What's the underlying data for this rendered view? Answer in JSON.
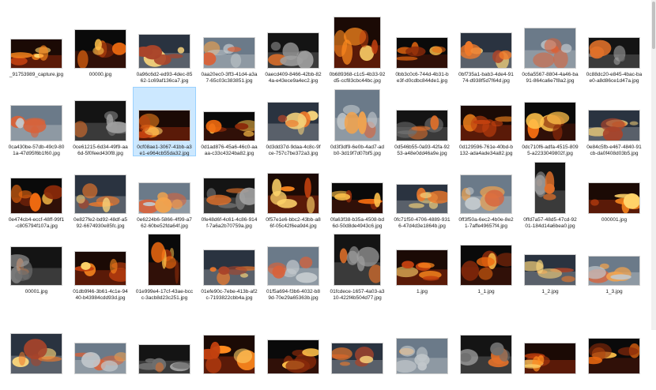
{
  "explorer": {
    "selected_index": 12,
    "rows": [
      [
        {
          "caption": "_91753989_capture.jpg",
          "icon": "image-icon"
        },
        {
          "caption": "00000.jpg",
          "icon": "image-icon"
        },
        {
          "caption": "0a96c6d2-ed93-4dec-85\n62-1c69af136ca7.jpg",
          "icon": "image-icon"
        },
        {
          "caption": "0aa20ec0-3ff3-41d4-a3a\n7-65c03c383851.jpg",
          "icon": "image-icon"
        },
        {
          "caption": "0aecd409-8466-42bb-82\n4a-e43ece9a4ec2.jpg",
          "icon": "image-icon"
        },
        {
          "caption": "0b689368-c1c5-4b33-92\nd5-ccf83cbc44bc.jpg",
          "icon": "image-icon"
        },
        {
          "caption": "0bb3c0c6-744d-4b31-b\ne3f-d0cdbc844de1.jpg",
          "icon": "image-icon"
        },
        {
          "caption": "0bf735a1-bab3-4de4-91\n74-d938f5d7f64d.jpg",
          "icon": "image-icon"
        },
        {
          "caption": "0c6a5567-8804-4a46-ba\n91-864ca6e7f8a2.jpg",
          "icon": "image-icon"
        },
        {
          "caption": "0c88dc20-e845-4bac-ba\ne0-a8d86ce1d47a.jpg",
          "icon": "image-icon"
        }
      ],
      [
        {
          "caption": "0ca430be-57db-49c9-80\n1a-47d95f6b1f60.jpg",
          "icon": "image-icon"
        },
        {
          "caption": "0ce61215-6d34-49f9-aa\n6d-5f0feed430f8.jpg",
          "icon": "image-icon"
        },
        {
          "caption": "0cf08ae1-3067-41bb-a3\ne1-e964cb55da32.jpg",
          "icon": "image-icon"
        },
        {
          "caption": "0d1ad876-45a6-46c0-aa\naa-c33c4324ba82.jpg",
          "icon": "image-icon"
        },
        {
          "caption": "0d3dd37d-9daa-4c8c-9f\nce-757c7be372a3.jpg",
          "icon": "image-icon"
        },
        {
          "caption": "0d3f3df9-6e0b-4ad7-ad\nb0-3d19f7d07bf5.jpg",
          "icon": "image-icon"
        },
        {
          "caption": "0d546b55-0a93-42fa-92\n53-a48e0dd46a9e.jpg",
          "icon": "image-icon"
        },
        {
          "caption": "0d129596-761e-40bd-b\n132-ada4ade34a82.jpg",
          "icon": "image-icon"
        },
        {
          "caption": "0dc710f6-adfa-4515-809\n5-a2233049802f.jpg",
          "icon": "image-icon"
        },
        {
          "caption": "0e84c5fb-e467-4840-91\ncb-da0f408d03b5.jpg",
          "icon": "image-icon"
        }
      ],
      [
        {
          "caption": "0e474cb4-eccf-48ff-99f1\n-c805794f107a.jpg",
          "icon": "image-icon"
        },
        {
          "caption": "0e827fe2-bd92-48df-a5\n92-6674930e85fc.jpg",
          "icon": "image-icon"
        },
        {
          "caption": "0e6224b6-5866-4f99-a7\n62-60be52fda64f.jpg",
          "icon": "image-icon"
        },
        {
          "caption": "0fe48d6f-4c61-4c86-914\nf-7a6a2b70759a.jpg",
          "icon": "image-icon"
        },
        {
          "caption": "0f57e1e6-bbc2-43bb-a8\n6f-05c42f6ea9d4.jpg",
          "icon": "image-icon"
        },
        {
          "caption": "0fa63f38-b35a-4508-bd\n6d-50d8de4943c6.jpg",
          "icon": "image-icon"
        },
        {
          "caption": "0fc71f50-4706-4889-931\n6-47d4d3e1864b.jpg",
          "icon": "image-icon"
        },
        {
          "caption": "0ff3f50a-6ec2-4b0e-8e2\n1-7affe49657f4.jpg",
          "icon": "image-icon"
        },
        {
          "caption": "0ffd7a57-48d5-47cd-92\n01-184d14a6bea0.jpg",
          "icon": "image-icon"
        },
        {
          "caption": "000001.jpg",
          "icon": "image-icon"
        }
      ],
      [
        {
          "caption": "00001.jpg",
          "icon": "image-icon"
        },
        {
          "caption": "01db9f46-3b61-4c1e-94\n40-b43984cdd93d.jpg",
          "icon": "image-icon"
        },
        {
          "caption": "01e999e4-17cf-43ae-bcc\nc-3acb8d23c251.jpg",
          "icon": "image-icon"
        },
        {
          "caption": "01efe90c-7ebe-413b-af2\nc-7193822cbb4a.jpg",
          "icon": "image-icon"
        },
        {
          "caption": "01f5a694-f3b6-4032-b8\n9d-70e29a65363b.jpg",
          "icon": "image-icon"
        },
        {
          "caption": "01fcdece-1657-4a03-a3\n10-422f4b504d77.jpg",
          "icon": "image-icon"
        },
        {
          "caption": "1.jpg",
          "icon": "image-icon"
        },
        {
          "caption": "1_1.jpg",
          "icon": "image-icon"
        },
        {
          "caption": "1_2.jpg",
          "icon": "image-icon"
        },
        {
          "caption": "1_3.jpg",
          "icon": "image-icon"
        }
      ],
      [
        {
          "caption": "",
          "icon": "image-icon"
        },
        {
          "caption": "",
          "icon": "image-icon"
        },
        {
          "caption": "",
          "icon": "image-icon"
        },
        {
          "caption": "",
          "icon": "image-icon"
        },
        {
          "caption": "",
          "icon": "image-icon"
        },
        {
          "caption": "",
          "icon": "image-icon"
        },
        {
          "caption": "",
          "icon": "image-icon"
        },
        {
          "caption": "",
          "icon": "image-icon"
        },
        {
          "caption": "",
          "icon": "image-icon"
        },
        {
          "caption": "",
          "icon": "image-icon"
        }
      ]
    ]
  }
}
